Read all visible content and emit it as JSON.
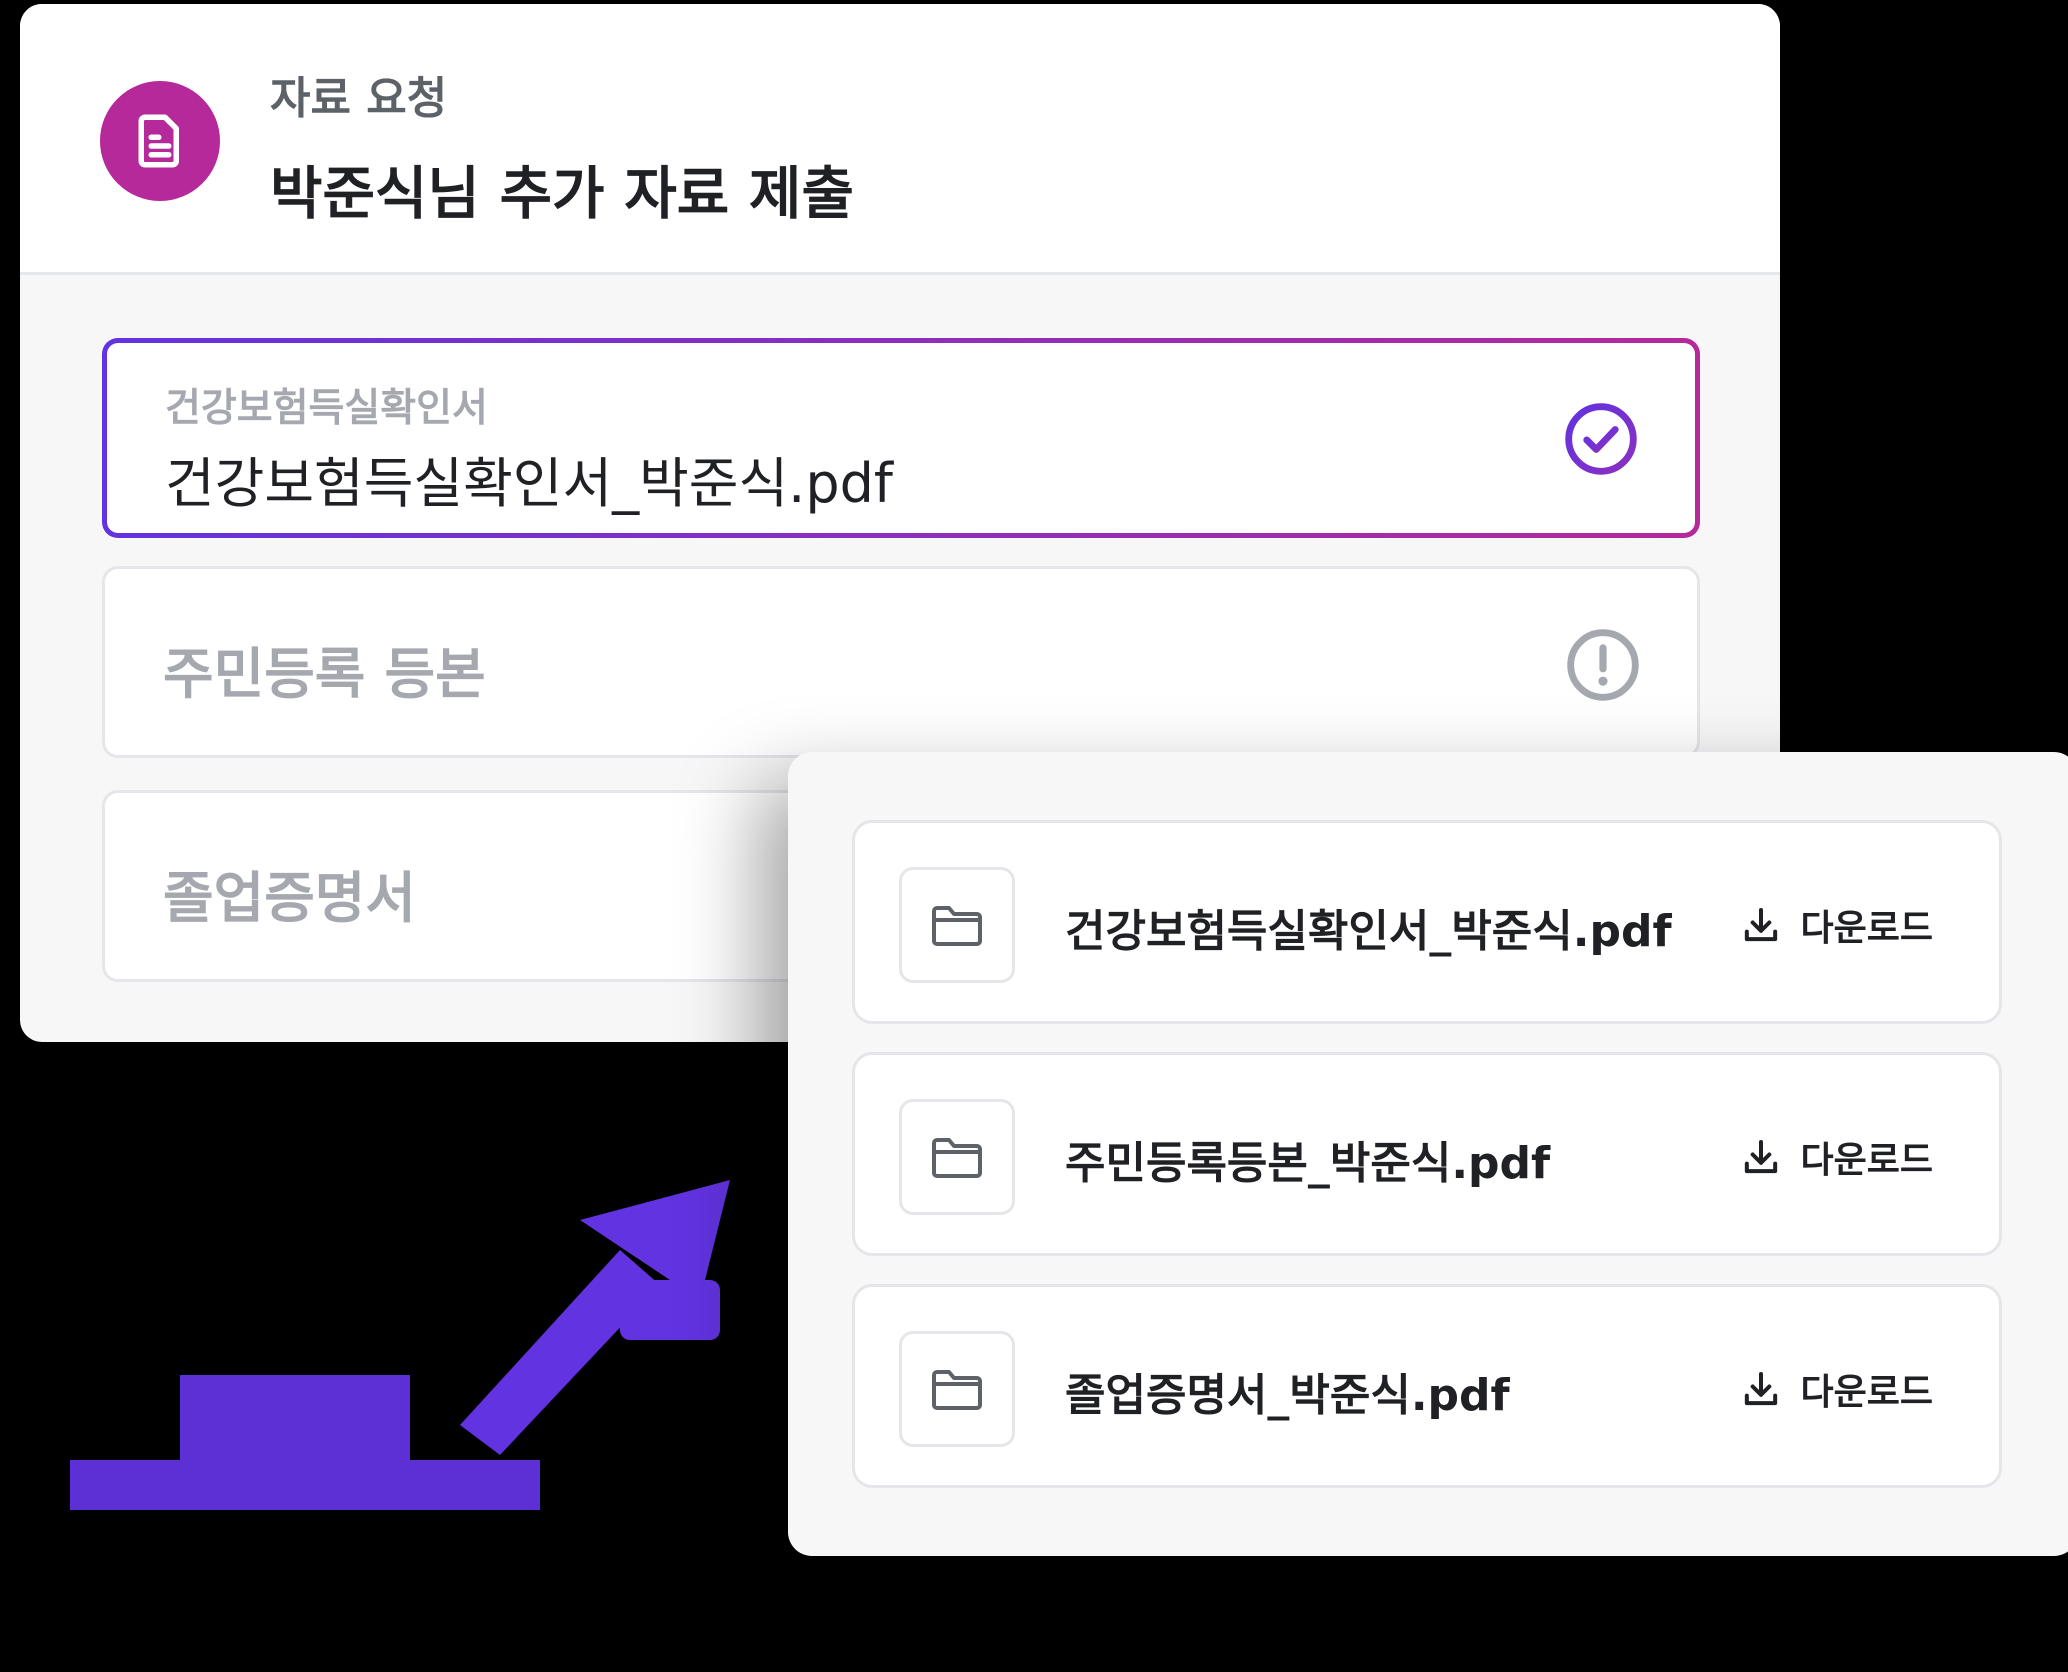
{
  "request": {
    "label": "자료 요청",
    "title": "박준식님 추가 자료 제출",
    "icon": "document-icon",
    "accent_color": "#b5299a",
    "fields": [
      {
        "label": "건강보험득실확인서",
        "value": "건강보험득실확인서_박준식.pdf",
        "status": "complete",
        "status_icon": "check-circle-icon"
      },
      {
        "placeholder": "주민등록 등본",
        "status": "missing",
        "status_icon": "alert-circle-icon"
      },
      {
        "placeholder": "졸업증명서"
      }
    ]
  },
  "files": {
    "items": [
      {
        "name": "건강보험득실확인서_박준식.pdf",
        "icon": "folder-icon",
        "download_label": "다운로드"
      },
      {
        "name": "주민등록등본_박준식.pdf",
        "icon": "folder-icon",
        "download_label": "다운로드"
      },
      {
        "name": "졸업증명서_박준식.pdf",
        "icon": "folder-icon",
        "download_label": "다운로드"
      }
    ]
  },
  "colors": {
    "gradient_start": "#6233e0",
    "gradient_end": "#b5299a",
    "pointer": "#6233e0"
  }
}
